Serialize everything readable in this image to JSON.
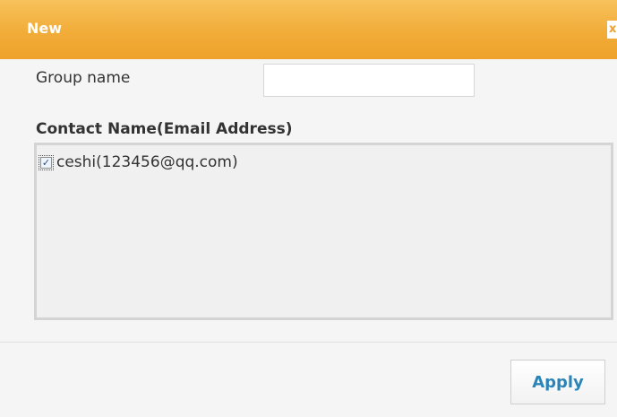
{
  "dialog": {
    "title": "New",
    "close_label": "x"
  },
  "form": {
    "group_name_label": "Group name",
    "group_name_value": "",
    "contacts_label": "Contact Name(Email Address)"
  },
  "contacts": [
    {
      "label": "ceshi(123456@qq.com)",
      "checked": true
    }
  ],
  "footer": {
    "apply_label": "Apply"
  },
  "colors": {
    "titlebar": "#f1ac38",
    "accent": "#2a84b8"
  }
}
